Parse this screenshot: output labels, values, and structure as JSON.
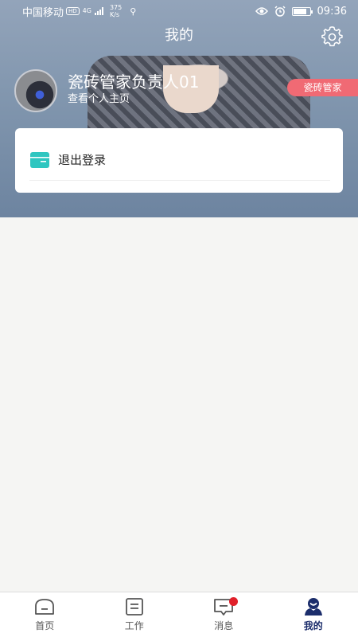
{
  "status_bar": {
    "carrier": "中国移动",
    "hd": "HD",
    "net_type": "4G",
    "speed_value": "375",
    "speed_unit": "K/s",
    "time": "09:36"
  },
  "header": {
    "title": "我的"
  },
  "profile": {
    "name": "瓷砖管家负责人01",
    "link_text": "查看个人主页",
    "role_badge": "瓷砖管家"
  },
  "menu": {
    "items": [
      {
        "label": "退出登录",
        "icon": "box-icon"
      }
    ]
  },
  "colors": {
    "accent": "#1b2d6b",
    "badge": "#f06a74",
    "menu_icon": "#2fc6c0",
    "notification": "#e0202a"
  },
  "tabbar": {
    "tabs": [
      {
        "label": "首页",
        "icon": "home-icon"
      },
      {
        "label": "工作",
        "icon": "work-icon"
      },
      {
        "label": "消息",
        "icon": "message-icon"
      },
      {
        "label": "我的",
        "icon": "profile-icon"
      }
    ],
    "active": "我的"
  }
}
